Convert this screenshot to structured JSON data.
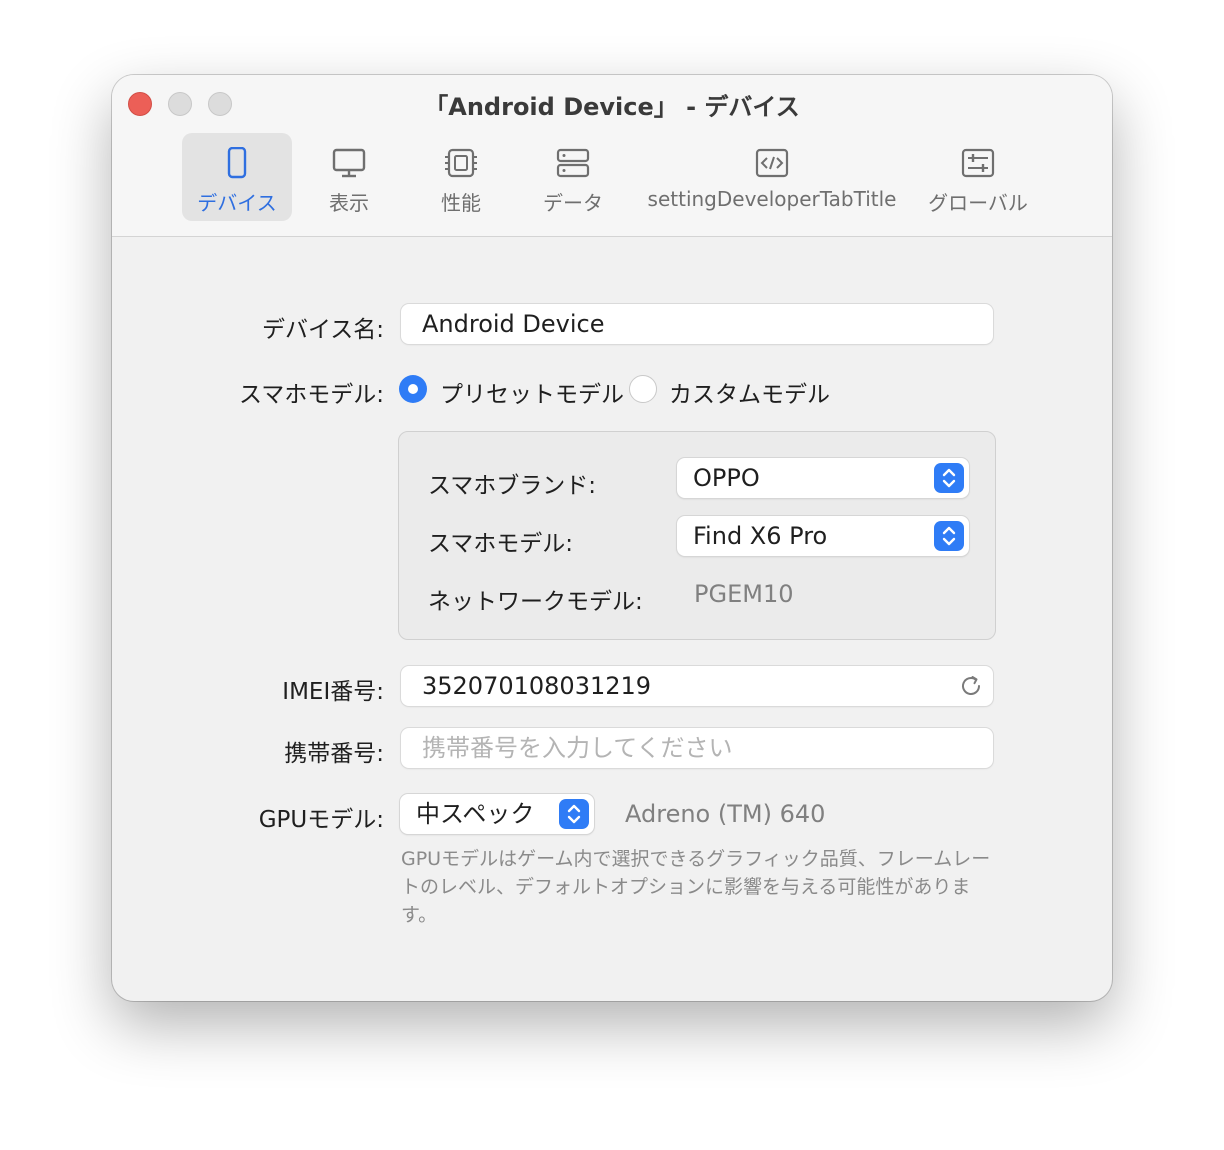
{
  "window": {
    "title": "「Android Device」 - デバイス"
  },
  "tabs": [
    {
      "label": "デバイス",
      "icon": "phone-icon",
      "active": true
    },
    {
      "label": "表示",
      "icon": "monitor-icon",
      "active": false
    },
    {
      "label": "性能",
      "icon": "cpu-icon",
      "active": false
    },
    {
      "label": "データ",
      "icon": "server-icon",
      "active": false
    },
    {
      "label": "settingDeveloperTabTitle",
      "icon": "code-icon",
      "active": false
    },
    {
      "label": "グローバル",
      "icon": "sliders-icon",
      "active": false
    }
  ],
  "form": {
    "device_name_label": "デバイス名:",
    "device_name_value": "Android Device",
    "model_label": "スマホモデル:",
    "model_option_preset": "プリセットモデル",
    "model_option_custom": "カスタムモデル",
    "model_selected": "preset",
    "brand_label": "スマホブランド:",
    "brand_value": "OPPO",
    "phone_model_label": "スマホモデル:",
    "phone_model_value": "Find X6 Pro",
    "network_model_label": "ネットワークモデル:",
    "network_model_value": "PGEM10",
    "imei_label": "IMEI番号:",
    "imei_value": "352070108031219",
    "phone_number_label": "携帯番号:",
    "phone_number_placeholder": "携帯番号を入力してください",
    "gpu_label": "GPUモデル:",
    "gpu_value": "中スペック",
    "gpu_name": "Adreno (TM) 640",
    "gpu_help": "GPUモデルはゲーム内で選択できるグラフィック品質、フレームレートのレベル、デフォルトオプションに影響を与える可能性があります。"
  },
  "colors": {
    "accent": "#2f7cf6",
    "close_button": "#ec5f57"
  }
}
